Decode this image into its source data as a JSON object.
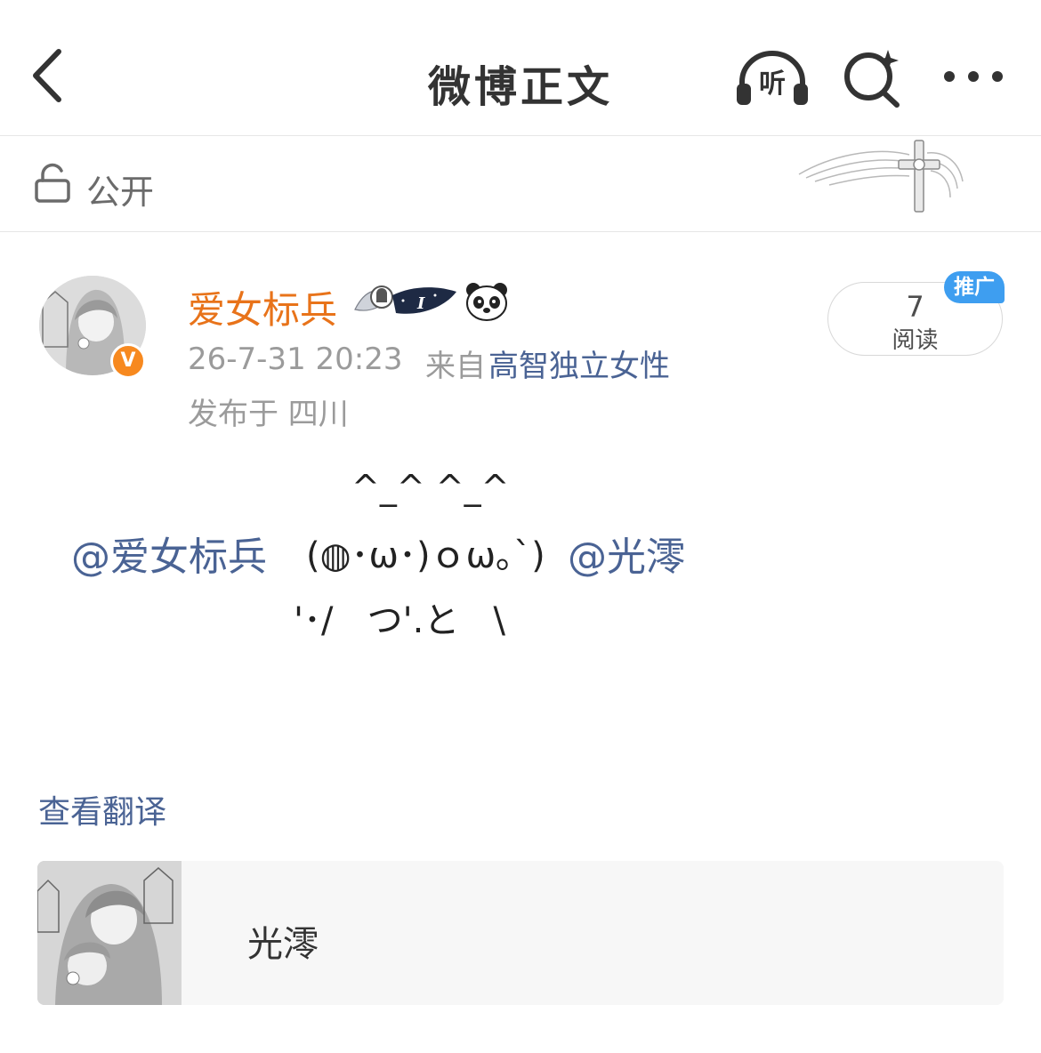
{
  "nav": {
    "title": "微博正文",
    "listen_label": "听",
    "icons": {
      "back": "chevron-left-icon",
      "listen": "headphones-icon",
      "search": "sparkle-search-icon",
      "more": "more-dots-icon"
    }
  },
  "visibility": {
    "label": "公开",
    "icon": "unlock-icon"
  },
  "post": {
    "username": "爱女标兵",
    "timestamp": "26-7-31 20:23",
    "source_prefix": "来自",
    "source_name": "高智独立女性",
    "location": "发布于 四川",
    "verified_mark": "V",
    "badge_text": "I",
    "read_count": "7",
    "read_label": "阅读",
    "promote_label": "推广",
    "body": {
      "line1": "^_^ ^_^",
      "mention_1": "@爱女标兵",
      "kaomoji": "(◍･ω･)ｏω｡`)",
      "mention_2": "@光澪",
      "line3": "'･/   つ'.と   \\"
    },
    "translate_label": "查看翻译"
  },
  "linked_user": {
    "name": "光澪"
  },
  "colors": {
    "username": "#e8731a",
    "link": "#4a6394",
    "promote": "#3e9ef0",
    "verified": "#f7891f"
  }
}
